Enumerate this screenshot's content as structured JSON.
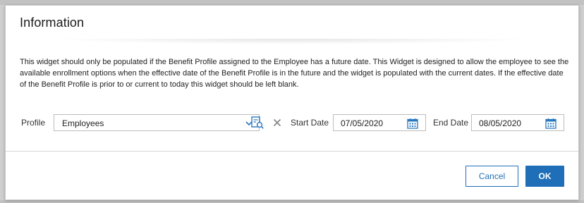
{
  "dialog": {
    "title": "Information",
    "description": "This widget should only be populated if the Benefit Profile assigned to the Employee has a future date. This Widget is designed to allow the employee to see the available enrollment options when the effective date of the Benefit Profile is in the future and the widget is populated with the current dates. If the effective date of the Benefit Profile is prior to or current to today this widget should be left blank."
  },
  "form": {
    "profile_label": "Profile",
    "profile_value": "Employees",
    "start_date_label": "Start Date",
    "start_date_value": "07/05/2020",
    "end_date_label": "End Date",
    "end_date_value": "08/05/2020"
  },
  "footer": {
    "cancel_label": "Cancel",
    "ok_label": "OK"
  },
  "colors": {
    "accent": "#1f6fb8",
    "icon": "#2a79c0",
    "clear_icon": "#888888"
  },
  "icons": {
    "profile_dropdown": "chevron-down-icon",
    "profile_lookup": "lookup-icon",
    "profile_clear": "close-icon",
    "calendar": "calendar-icon"
  }
}
